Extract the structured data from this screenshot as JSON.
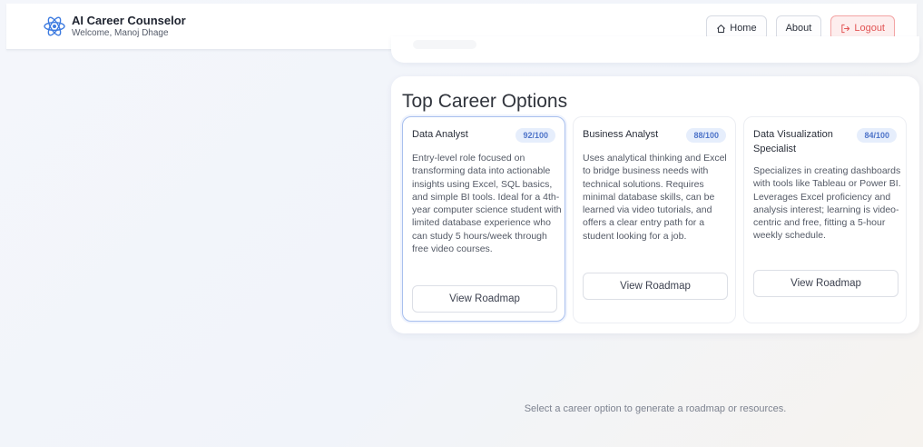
{
  "header": {
    "title": "AI Career Counselor",
    "welcome": "Welcome, Manoj Dhage",
    "nav": {
      "home": "Home",
      "about": "About",
      "logout": "Logout"
    }
  },
  "section": {
    "title": "Top Career Options",
    "button_label": "View Roadmap",
    "cards": [
      {
        "title": "Data Analyst",
        "score": "92/100",
        "description": "Entry-level role focused on transforming data into actionable insights using Excel, SQL basics, and simple BI tools. Ideal for a 4th-year computer science student with limited database experience who can study 5 hours/week through free video courses."
      },
      {
        "title": "Business Analyst",
        "score": "88/100",
        "description": "Uses analytical thinking and Excel to bridge business needs with technical solutions. Requires minimal database skills, can be learned via video tutorials, and offers a clear entry path for a student looking for a job."
      },
      {
        "title": "Data Visualization Specialist",
        "score": "84/100",
        "description": "Specializes in creating dashboards with tools like Tableau or Power BI. Leverages Excel proficiency and analysis interest; learning is video-centric and free, fitting a 5-hour weekly schedule."
      }
    ]
  },
  "footer": {
    "message": "Select a career option to generate a roadmap or resources."
  },
  "icons": {
    "logo": "atom-icon",
    "home": "home-icon",
    "logout": "logout-icon"
  },
  "colors": {
    "accent": "#4e74c9",
    "logout": "#e25656",
    "logo": "#3d7be0"
  }
}
